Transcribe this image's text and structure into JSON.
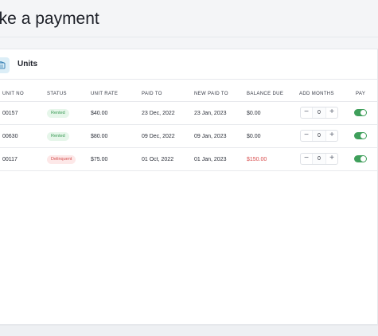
{
  "page": {
    "title": "ake a payment"
  },
  "units_section": {
    "title": "Units",
    "icon": "storage-unit-icon",
    "icon_color": "#dceef7"
  },
  "table": {
    "columns": {
      "unit_no": "UNIT NO",
      "status": "STATUS",
      "unit_rate": "UNIT RATE",
      "paid_to": "PAID TO",
      "new_paid_to": "NEW PAID TO",
      "balance_due": "BALANCE DUE",
      "add_months": "ADD MONTHS",
      "pay": "PAY"
    },
    "rows": [
      {
        "unit_no": "00157",
        "status": "Rented",
        "unit_rate": "$40.00",
        "paid_to": "23 Dec, 2022",
        "new_paid_to": "23 Jan, 2023",
        "balance_due": "$0.00",
        "add_months": "0",
        "pay": true
      },
      {
        "unit_no": "00630",
        "status": "Rented",
        "unit_rate": "$80.00",
        "paid_to": "09 Dec, 2022",
        "new_paid_to": "09 Jan, 2023",
        "balance_due": "$0.00",
        "add_months": "0",
        "pay": true
      },
      {
        "unit_no": "00117",
        "status": "Delinquent",
        "unit_rate": "$75.00",
        "paid_to": "01 Oct, 2022",
        "new_paid_to": "01 Jan, 2023",
        "balance_due": "$150.00",
        "add_months": "0",
        "pay": true
      }
    ],
    "stepper": {
      "minus": "−",
      "plus": "+"
    }
  },
  "colors": {
    "rented_badge_bg": "#e6f6ea",
    "rented_badge_text": "#3a9a55",
    "delinquent_badge_bg": "#fde8e8",
    "delinquent_badge_text": "#d44d4d",
    "toggle_on": "#3f9f5b",
    "balance_due_warning": "#d84d4d"
  }
}
